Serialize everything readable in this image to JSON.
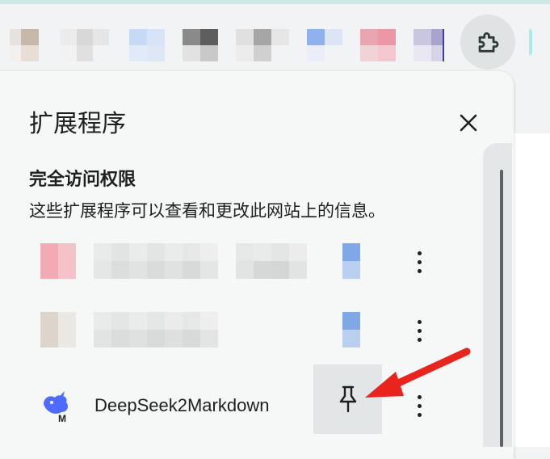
{
  "panel": {
    "title": "扩展程序",
    "close_icon": "close-icon"
  },
  "section": {
    "title": "完全访问权限",
    "description": "这些扩展程序可以查看和更改此网站上的信息。"
  },
  "extensions": [
    {
      "name": "",
      "icon": "blurred-extension-icon",
      "menu_icon": "more-vert-icon"
    },
    {
      "name": "",
      "icon": "blurred-extension-icon",
      "menu_icon": "more-vert-icon"
    },
    {
      "name": "DeepSeek2Markdown",
      "icon": "deepseek-whale-icon",
      "pin_icon": "pin-icon",
      "menu_icon": "more-vert-icon"
    }
  ],
  "toolbar": {
    "extensions_button_icon": "puzzle-piece-icon"
  },
  "colors": {
    "accent_arrow": "#e8241c",
    "panel_bg": "#f6f8f8",
    "deepseek_blue": "#4d6bfe"
  }
}
